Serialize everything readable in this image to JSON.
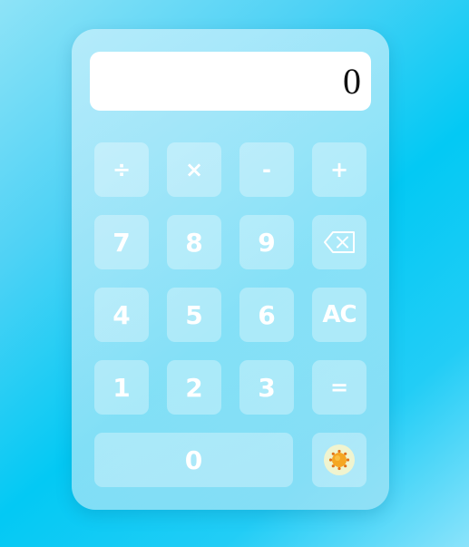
{
  "display": {
    "value": "0"
  },
  "keys": {
    "divide": "÷",
    "multiply": "×",
    "subtract": "-",
    "add": "+",
    "seven": "7",
    "eight": "8",
    "nine": "9",
    "four": "4",
    "five": "5",
    "six": "6",
    "clear": "AC",
    "one": "1",
    "two": "2",
    "three": "3",
    "equals": "=",
    "zero": "0"
  },
  "icons": {
    "backspace": "backspace-icon",
    "theme": "sun-icon"
  },
  "colors": {
    "key_text": "#ffffff",
    "display_bg": "#ffffff",
    "sun": "#f5a623"
  }
}
